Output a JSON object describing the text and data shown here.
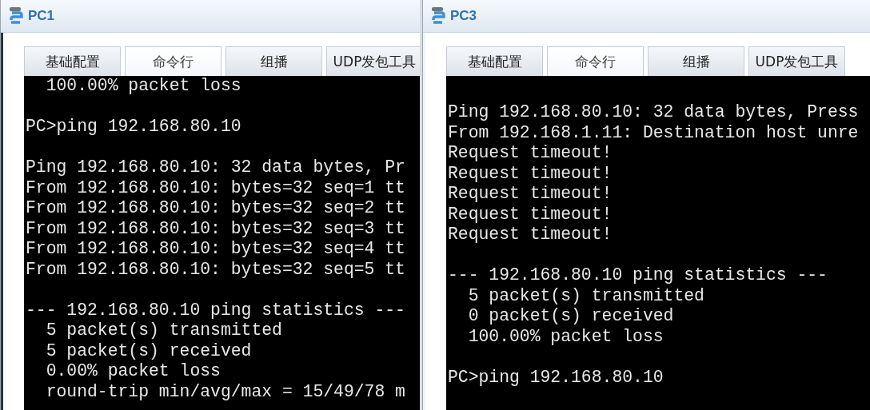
{
  "windows": [
    {
      "title": "PC1",
      "tabs": [
        {
          "label": "基础配置",
          "selected": false
        },
        {
          "label": "命令行",
          "selected": true
        },
        {
          "label": "组播",
          "selected": false
        },
        {
          "label": "UDP发包工具",
          "selected": false
        }
      ],
      "terminal_blocks": [
        [
          "  100.00% packet loss"
        ],
        [
          "PC>ping 192.168.80.10"
        ],
        [
          "Ping 192.168.80.10: 32 data bytes, Pr",
          "From 192.168.80.10: bytes=32 seq=1 tt",
          "From 192.168.80.10: bytes=32 seq=2 tt",
          "From 192.168.80.10: bytes=32 seq=3 tt",
          "From 192.168.80.10: bytes=32 seq=4 tt",
          "From 192.168.80.10: bytes=32 seq=5 tt"
        ],
        [
          "--- 192.168.80.10 ping statistics ---",
          "  5 packet(s) transmitted",
          "  5 packet(s) received",
          "  0.00% packet loss",
          "  round-trip min/avg/max = 15/49/78 m"
        ]
      ]
    },
    {
      "title": "PC3",
      "tabs": [
        {
          "label": "基础配置",
          "selected": false
        },
        {
          "label": "命令行",
          "selected": true
        },
        {
          "label": "组播",
          "selected": false
        },
        {
          "label": "UDP发包工具",
          "selected": false
        }
      ],
      "terminal_blocks": [
        [
          "Ping 192.168.80.10: 32 data bytes, Press",
          "From 192.168.1.11: Destination host unre",
          "Request timeout!",
          "Request timeout!",
          "Request timeout!",
          "Request timeout!",
          "Request timeout!"
        ],
        [
          "--- 192.168.80.10 ping statistics ---",
          "  5 packet(s) transmitted",
          "  0 packet(s) received",
          "  100.00% packet loss"
        ],
        [
          "PC>ping 192.168.80.10"
        ]
      ]
    }
  ]
}
